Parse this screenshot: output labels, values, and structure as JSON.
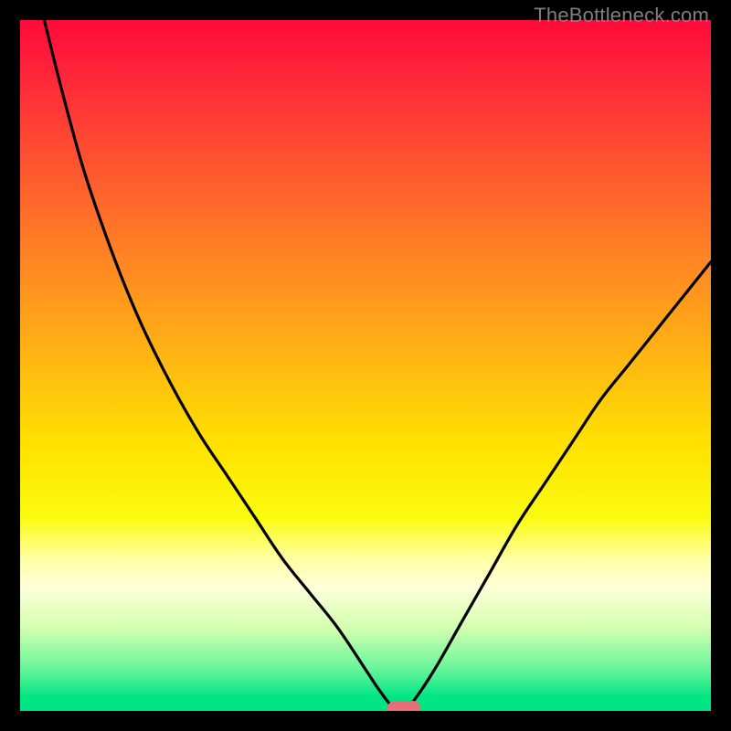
{
  "attribution": "TheBottleneck.com",
  "colors": {
    "background_black": "#000000",
    "gradient_top": "#ff0a3a",
    "gradient_mid_orange": "#ff7c26",
    "gradient_yellow": "#ffe300",
    "gradient_pale": "#ffffd9",
    "gradient_green": "#00e582",
    "curve_stroke": "#000000",
    "marker_fill": "#e86f78",
    "attribution_text": "#7f7f7f"
  },
  "chart_data": {
    "type": "line",
    "title": "",
    "xlabel": "",
    "ylabel": "",
    "xlim": [
      0,
      100
    ],
    "ylim": [
      0,
      100
    ],
    "grid": false,
    "x": [
      3.5,
      6,
      9,
      12,
      15,
      18,
      22,
      26,
      30,
      34,
      38,
      42,
      46,
      50,
      52,
      54,
      55.5,
      57,
      60,
      64,
      68,
      72,
      76,
      80,
      84,
      88,
      92,
      96,
      100
    ],
    "values": [
      100,
      90,
      79,
      70,
      62,
      55,
      47,
      40,
      34,
      28,
      22,
      17,
      12,
      6,
      3,
      0.5,
      0,
      1.5,
      6,
      13,
      20,
      27,
      33,
      39,
      45,
      50,
      55,
      60,
      65
    ],
    "minimum_x": 55.5,
    "marker": {
      "x_center": 55.5,
      "y_center": 0.4,
      "label": ""
    },
    "notes": "V-shaped mismatch curve over a vertical heat-map gradient. Axis values are estimated from geometry; no numeric tick labels are rendered in the source image."
  }
}
